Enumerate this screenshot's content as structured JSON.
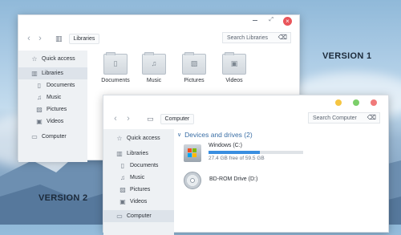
{
  "background": {
    "version1_label": "VERSION 1",
    "version2_label": "VERSION 2"
  },
  "window1": {
    "controls": [
      "minimize-icon",
      "maximize-icon",
      "close-icon"
    ],
    "breadcrumb": "Libraries",
    "search_placeholder": "Search Libraries",
    "sidebar": [
      {
        "icon": "star-icon",
        "label": "Quick access"
      },
      {
        "icon": "library-icon",
        "label": "Libraries",
        "selected": true
      },
      {
        "icon": "document-icon",
        "label": "Documents"
      },
      {
        "icon": "music-icon",
        "label": "Music"
      },
      {
        "icon": "pictures-icon",
        "label": "Pictures"
      },
      {
        "icon": "video-icon",
        "label": "Videos"
      },
      {
        "icon": "computer-icon",
        "label": "Computer"
      }
    ],
    "folders": [
      {
        "icon": "document-icon",
        "label": "Documents"
      },
      {
        "icon": "music-icon",
        "label": "Music"
      },
      {
        "icon": "pictures-icon",
        "label": "Pictures"
      },
      {
        "icon": "video-icon",
        "label": "Videos"
      }
    ]
  },
  "window2": {
    "controls": {
      "minimize": "#f5c542",
      "maximize": "#7ccf6a",
      "close": "#f07a7a"
    },
    "breadcrumb": "Computer",
    "search_placeholder": "Search Computer",
    "sidebar": [
      {
        "icon": "star-icon",
        "label": "Quick access"
      },
      {
        "icon": "library-icon",
        "label": "Libraries"
      },
      {
        "icon": "document-icon",
        "label": "Documents"
      },
      {
        "icon": "music-icon",
        "label": "Music"
      },
      {
        "icon": "pictures-icon",
        "label": "Pictures"
      },
      {
        "icon": "video-icon",
        "label": "Videos"
      },
      {
        "icon": "computer-icon",
        "label": "Computer",
        "selected": true
      }
    ],
    "group_title": "Devices and drives (2)",
    "drives": [
      {
        "icon": "windows-drive-icon",
        "name": "Windows (C:)",
        "free_text": "27.4 GB free of 59.5 GB",
        "used_fraction": 0.54
      },
      {
        "icon": "disc-drive-icon",
        "name": "BD-ROM Drive (D:)"
      }
    ]
  }
}
